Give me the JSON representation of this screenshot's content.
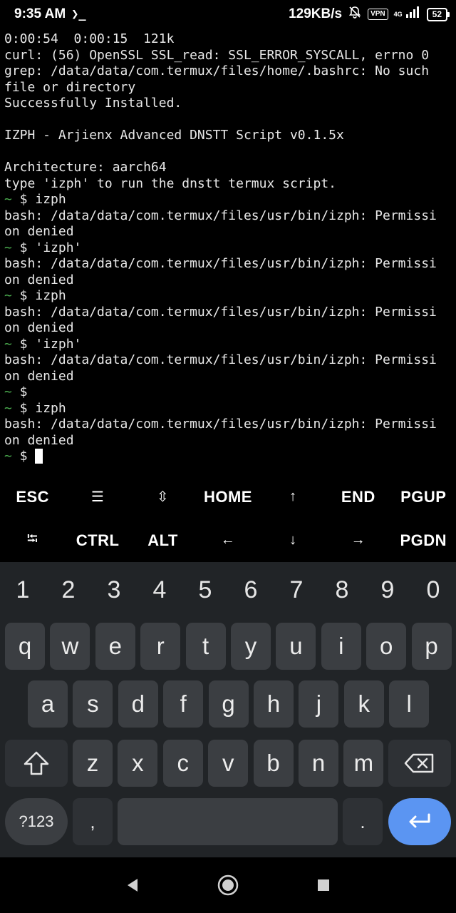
{
  "status_bar": {
    "time": "9:35 AM",
    "terminal_indicator": "❯_",
    "net_speed": "129KB/s",
    "vpn": "VPN",
    "network_type": "4G",
    "battery": "52"
  },
  "terminal": {
    "lines": [
      {
        "text": "0:00:54  0:00:15  121k"
      },
      {
        "text": "curl: (56) OpenSSL SSL_read: SSL_ERROR_SYSCALL, errno 0"
      },
      {
        "text": "grep: /data/data/com.termux/files/home/.bashrc: No such"
      },
      {
        "text": "file or directory"
      },
      {
        "text": "Successfully Installed."
      },
      {
        "text": ""
      },
      {
        "text": "IZPH - Arjienx Advanced DNSTT Script v0.1.5x"
      },
      {
        "text": ""
      },
      {
        "text": "Architecture: aarch64"
      },
      {
        "text": "type 'izph' to run the dnstt termux script."
      },
      {
        "prompt": "~",
        "text": " $ izph"
      },
      {
        "text": "bash: /data/data/com.termux/files/usr/bin/izph: Permissi"
      },
      {
        "text": "on denied"
      },
      {
        "prompt": "~",
        "text": " $ 'izph'"
      },
      {
        "text": "bash: /data/data/com.termux/files/usr/bin/izph: Permissi"
      },
      {
        "text": "on denied"
      },
      {
        "prompt": "~",
        "text": " $ izph"
      },
      {
        "text": "bash: /data/data/com.termux/files/usr/bin/izph: Permissi"
      },
      {
        "text": "on denied"
      },
      {
        "prompt": "~",
        "text": " $ 'izph'"
      },
      {
        "text": "bash: /data/data/com.termux/files/usr/bin/izph: Permissi"
      },
      {
        "text": "on denied"
      },
      {
        "prompt": "~",
        "text": " $"
      },
      {
        "prompt": "~",
        "text": " $ izph"
      },
      {
        "text": "bash: /data/data/com.termux/files/usr/bin/izph: Permissi"
      },
      {
        "text": "on denied"
      }
    ],
    "current_prompt": "~",
    "current_input": " $ "
  },
  "extra_keys": {
    "row1": [
      {
        "label": "ESC",
        "name": "esc-key"
      },
      {
        "label": "☰",
        "name": "drawer-key",
        "sym": true
      },
      {
        "label": "⇳",
        "name": "keyboard-toggle-key",
        "sym": true
      },
      {
        "label": "HOME",
        "name": "home-key"
      },
      {
        "label": "↑",
        "name": "arrow-up-key",
        "sym": true
      },
      {
        "label": "END",
        "name": "end-key"
      },
      {
        "label": "PGUP",
        "name": "pgup-key"
      }
    ],
    "row2": [
      {
        "label": "⭾",
        "name": "tab-key",
        "sym": true
      },
      {
        "label": "CTRL",
        "name": "ctrl-key"
      },
      {
        "label": "ALT",
        "name": "alt-key"
      },
      {
        "label": "←",
        "name": "arrow-left-key",
        "sym": true
      },
      {
        "label": "↓",
        "name": "arrow-down-key",
        "sym": true
      },
      {
        "label": "→",
        "name": "arrow-right-key",
        "sym": true
      },
      {
        "label": "PGDN",
        "name": "pgdn-key"
      }
    ]
  },
  "keyboard": {
    "numbers": [
      "1",
      "2",
      "3",
      "4",
      "5",
      "6",
      "7",
      "8",
      "9",
      "0"
    ],
    "row1": [
      "q",
      "w",
      "e",
      "r",
      "t",
      "y",
      "u",
      "i",
      "o",
      "p"
    ],
    "row2": [
      "a",
      "s",
      "d",
      "f",
      "g",
      "h",
      "j",
      "k",
      "l"
    ],
    "row3": [
      "z",
      "x",
      "c",
      "v",
      "b",
      "n",
      "m"
    ],
    "symbols_label": "?123",
    "comma": ",",
    "period": "."
  },
  "colors": {
    "background": "#000000",
    "keyboard_bg": "#212427",
    "key_bg": "#3b3e42",
    "enter_key": "#5b95f2",
    "prompt_tilde": "#4caf50"
  }
}
